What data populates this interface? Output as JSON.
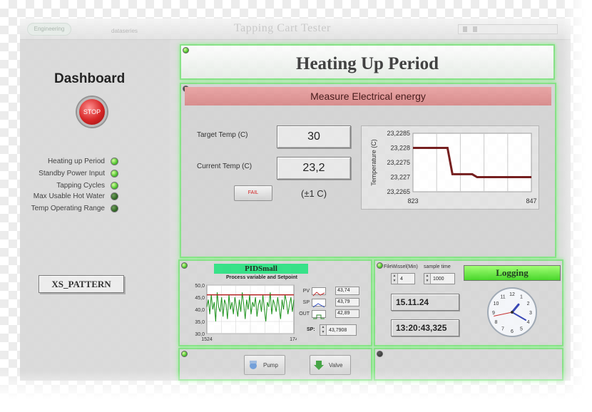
{
  "window": {
    "title": "Tapping Cart Tester",
    "logo_text": "Engineering",
    "subtitle": "dataseries"
  },
  "dashboard": {
    "title": "Dashboard",
    "stop_label": "STOP",
    "status_items": [
      {
        "label": "Heating up Period",
        "state": "on"
      },
      {
        "label": "Standby Power Input",
        "state": "on"
      },
      {
        "label": "Tapping Cycles",
        "state": "on"
      },
      {
        "label": "Max Usable Hot Water",
        "state": "off"
      },
      {
        "label": "Temp Operating Range",
        "state": "off"
      }
    ],
    "pattern_label": "XS_PATTERN"
  },
  "heading": "Heating Up Period",
  "energy": {
    "header": "Measure Electrical energy",
    "target_label": "Target Temp (C)",
    "target_value": "30",
    "current_label": "Current Temp (C)",
    "current_value": "23,2",
    "fail_label": "FAIL",
    "tolerance": "(±1 C)"
  },
  "pid": {
    "title": "PIDSmall",
    "subtitle": "Process variable and Setpoint",
    "legend": [
      {
        "name": "PV",
        "value": "43,74"
      },
      {
        "name": "SP",
        "value": "43,79"
      },
      {
        "name": "OUT",
        "value": "42,89"
      }
    ],
    "sp_label": "SP:",
    "sp_value": "43,7908"
  },
  "logging": {
    "filewissel_label": "FileWissel(Min)",
    "filewissel_value": "4",
    "sample_label": "sample time",
    "sample_value": "1000",
    "status_label": "Logging",
    "date": "15.11.24",
    "time": "13:20:43,325",
    "clock": {
      "hour": 1,
      "minute": 20,
      "second": 43
    }
  },
  "actuators": {
    "pump_label": "Pump",
    "valve_label": "Valve"
  },
  "colors": {
    "panel_glow": "#7ee07e",
    "led_on": "#3fc01d",
    "header_red": "#d68686",
    "pid_title_bg": "#28e080",
    "plot_line": "#6b0e0e",
    "pid_series": "#0a8a0a",
    "setpoint": "#b01010"
  },
  "chart_data": [
    {
      "type": "line",
      "ylabel": "Temperature (C)",
      "x_ticks": [
        "823",
        "847"
      ],
      "y_ticks": [
        "23,2285",
        "23,228",
        "23,2275",
        "23,227",
        "23,2265"
      ],
      "xlim": [
        823,
        847
      ],
      "ylim": [
        23.2265,
        23.2285
      ],
      "grid": true,
      "series": [
        {
          "x": [
            823,
            830,
            831,
            835,
            836,
            840,
            841,
            847
          ],
          "y": [
            23.228,
            23.228,
            23.2271,
            23.2271,
            23.227,
            23.227,
            23.227,
            23.227
          ]
        }
      ]
    },
    {
      "type": "line",
      "title": "PIDSmall",
      "subtitle": "Process variable and Setpoint",
      "x_ticks": [
        "1524",
        "174"
      ],
      "y_ticks": [
        "50,0",
        "45,0",
        "40,0",
        "35,0",
        "30,0"
      ],
      "ylim": [
        30,
        50
      ],
      "grid": true,
      "series": [
        {
          "name": "PV",
          "values": [
            41,
            44,
            38,
            46,
            40,
            43,
            35,
            47,
            41,
            39,
            45,
            37,
            44,
            42,
            36,
            46,
            40,
            43,
            38,
            45,
            41,
            37,
            44,
            39,
            47,
            42,
            36,
            44,
            40,
            46,
            38,
            43,
            41,
            45,
            37,
            42,
            44,
            39,
            46,
            40,
            35,
            43,
            41,
            47,
            38,
            44,
            42,
            39,
            45,
            41,
            36,
            44,
            40,
            46,
            43,
            38,
            42,
            45,
            39,
            44
          ]
        },
        {
          "name": "SP",
          "values": [
            46,
            46
          ]
        }
      ]
    }
  ]
}
